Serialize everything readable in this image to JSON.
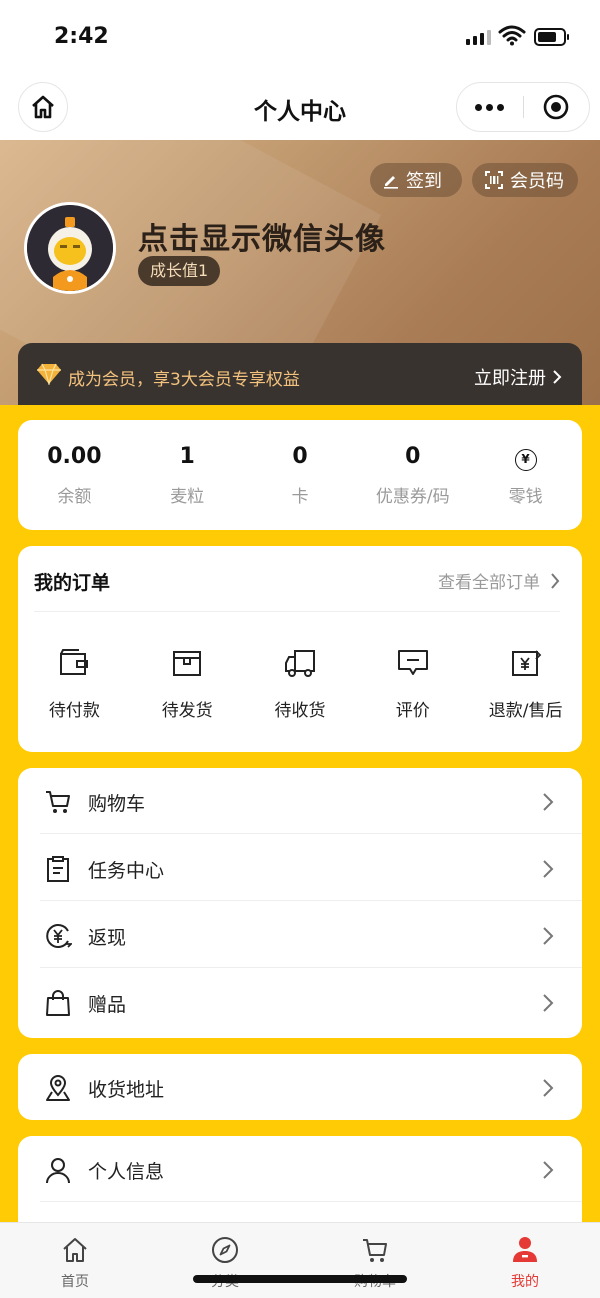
{
  "status_bar": {
    "time": "2:42"
  },
  "navbar": {
    "title": "个人中心"
  },
  "header": {
    "sign_in_label": "签到",
    "member_code_label": "会员码",
    "nickname": "点击显示微信头像",
    "growth": "成长值1",
    "vip_promo": "成为会员，享3大会员专享权益",
    "register_label": "立即注册"
  },
  "stats": [
    {
      "value": "0.00",
      "label": "余额"
    },
    {
      "value": "1",
      "label": "麦粒"
    },
    {
      "value": "0",
      "label": "卡"
    },
    {
      "value": "0",
      "label": "优惠券/码"
    },
    {
      "icon": "yen-circle-icon",
      "label": "零钱"
    }
  ],
  "orders": {
    "title": "我的订单",
    "view_all": "查看全部订单",
    "items": [
      {
        "label": "待付款",
        "icon": "wallet-icon"
      },
      {
        "label": "待发货",
        "icon": "box-icon"
      },
      {
        "label": "待收货",
        "icon": "truck-icon"
      },
      {
        "label": "评价",
        "icon": "comment-icon"
      },
      {
        "label": "退款/售后",
        "icon": "refund-icon"
      }
    ]
  },
  "menu": [
    {
      "label": "购物车",
      "icon": "cart-icon"
    },
    {
      "label": "任务中心",
      "icon": "clipboard-icon"
    },
    {
      "label": "返现",
      "icon": "cashback-icon"
    },
    {
      "label": "赠品",
      "icon": "gift-bag-icon"
    }
  ],
  "menu2": [
    {
      "label": "收货地址",
      "icon": "location-icon"
    }
  ],
  "menu3": [
    {
      "label": "个人信息",
      "icon": "person-icon"
    }
  ],
  "tabbar": [
    {
      "label": "首页",
      "icon": "home-icon"
    },
    {
      "label": "分类",
      "icon": "compass-icon"
    },
    {
      "label": "购物车",
      "icon": "cart-icon"
    },
    {
      "label": "我的",
      "icon": "user-icon",
      "active": true
    }
  ],
  "colors": {
    "brand_yellow": "#ffcb05",
    "active_red": "#e53935",
    "vip_gold": "#f3c27e"
  }
}
